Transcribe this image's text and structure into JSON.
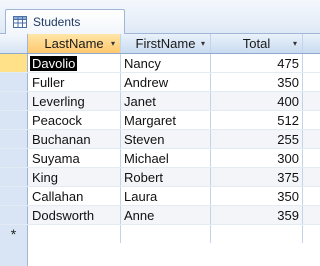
{
  "tab": {
    "label": "Students",
    "icon": "table-icon"
  },
  "columns": [
    {
      "label": "LastName"
    },
    {
      "label": "FirstName"
    },
    {
      "label": "Total"
    }
  ],
  "rows": [
    {
      "last": "Davolio",
      "first": "Nancy",
      "total": "475"
    },
    {
      "last": "Fuller",
      "first": "Andrew",
      "total": "350"
    },
    {
      "last": "Leverling",
      "first": "Janet",
      "total": "400"
    },
    {
      "last": "Peacock",
      "first": "Margaret",
      "total": "512"
    },
    {
      "last": "Buchanan",
      "first": "Steven",
      "total": "255"
    },
    {
      "last": "Suyama",
      "first": "Michael",
      "total": "300"
    },
    {
      "last": "King",
      "first": "Robert",
      "total": "375"
    },
    {
      "last": "Callahan",
      "first": "Laura",
      "total": "350"
    },
    {
      "last": "Dodsworth",
      "first": "Anne",
      "total": "359"
    }
  ],
  "new_row_marker": "*",
  "sort_glyph": "▾"
}
